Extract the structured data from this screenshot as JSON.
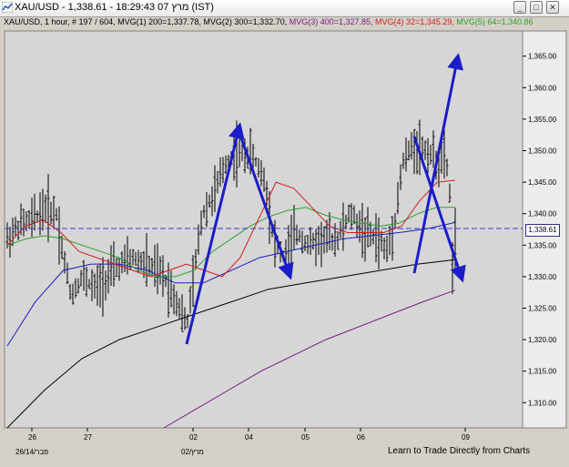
{
  "window": {
    "title": "XAU/USD - 1,338.61 - 18:29:43  07 מרץ (IST)",
    "buttons": {
      "minimize": "_",
      "maximize": "□",
      "close": "✕"
    }
  },
  "infobar": {
    "symbol": "XAU/USD",
    "timeframe": ", 1 hour, # 197 / 604,",
    "ma1": " MVG(1) 200=1,337.78,",
    "ma2": " MVG(2) 300=1,332.70,",
    "ma3": " MVG(3) 400=1,327.85,",
    "ma4": " MVG(4) 32=1,345.29,",
    "ma5": " MVG(5) 64=1,340.86"
  },
  "colors": {
    "ma1": "#1d1dbf",
    "ma2": "#000000",
    "ma3": "#7a1a7a",
    "ma4": "#d21e1e",
    "ma5": "#2aa02a",
    "arrows": "#1c1cc8",
    "plot_bg": "#d8d8d8"
  },
  "chart_data": {
    "type": "ohlc",
    "current_price": "1,338.61",
    "y_ticks": [
      "1,365.00",
      "1,360.00",
      "1,355.00",
      "1,350.00",
      "1,345.00",
      "1,340.00",
      "1,335.00",
      "1,330.00",
      "1,325.00",
      "1,320.00",
      "1,315.00",
      "1,310.00"
    ],
    "x_ticks": [
      "26",
      "27",
      "02",
      "04",
      "05",
      "06",
      "09"
    ],
    "ylim": [
      1306,
      1369
    ],
    "ma_curves": {
      "ma4_32": [
        1335,
        1338,
        1339,
        1337,
        1334,
        1333,
        1332,
        1331,
        1330,
        1331,
        1332,
        1331,
        1330,
        1333,
        1339,
        1345,
        1344,
        1341,
        1338,
        1337,
        1337,
        1337,
        1338,
        1342,
        1345,
        1345.3
      ],
      "ma5_64": [
        1335,
        1336,
        1336.5,
        1336,
        1335,
        1334,
        1333,
        1331,
        1330,
        1330,
        1331,
        1334,
        1336,
        1338,
        1339.5,
        1340.5,
        1341,
        1339.8,
        1339,
        1338.5,
        1338,
        1338.5,
        1340,
        1341,
        1341
      ],
      "ma1_200": [
        1319,
        1326,
        1331,
        1332,
        1332,
        1331,
        1329,
        1329,
        1331,
        1333,
        1334,
        1335,
        1336,
        1336.5,
        1337,
        1337.6,
        1338.6
      ],
      "ma2_300": [
        1306,
        1312,
        1317,
        1320,
        1322,
        1324,
        1326,
        1328,
        1329,
        1330,
        1331,
        1332,
        1332.7
      ],
      "ma3_400": [
        1306,
        1309,
        1312,
        1315,
        1317.5,
        1320,
        1322,
        1324,
        1326,
        1327.85
      ]
    },
    "annotations": "Five blue trend arrows drawn on the chart"
  },
  "footer": {
    "date_left": "26/14/פבר",
    "date_mid": "02/מרץ",
    "learn_link": "Learn to Trade Directly from Charts"
  }
}
